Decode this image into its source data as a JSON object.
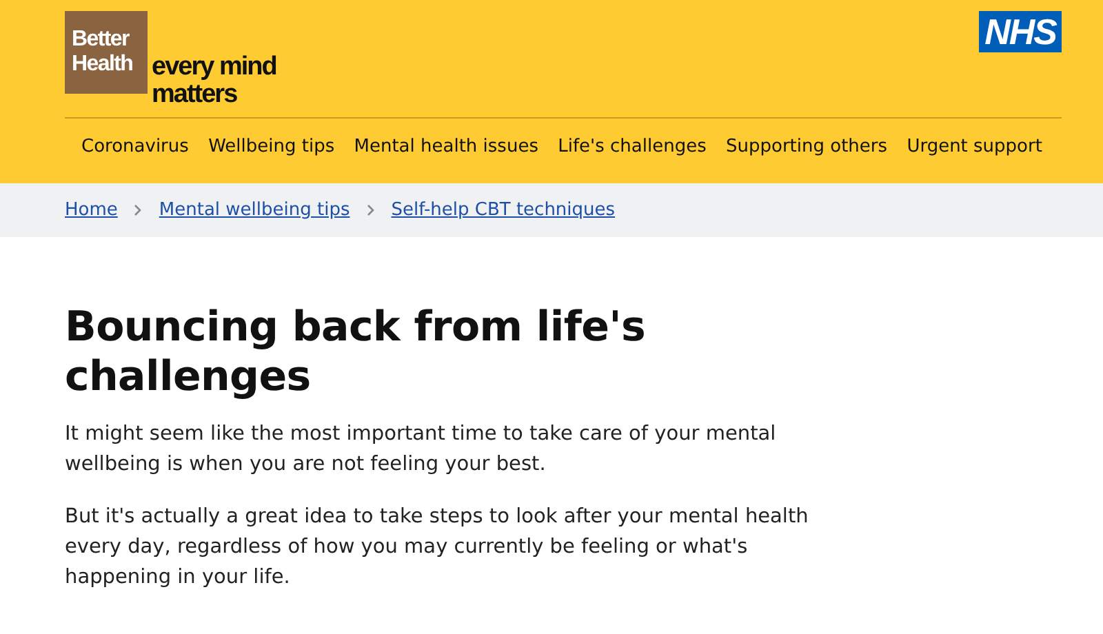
{
  "header": {
    "logo": {
      "box_lines": [
        "Better",
        "Health"
      ],
      "tagline_lines": [
        "every mind",
        "matters"
      ]
    },
    "nhs_logo": "NHS"
  },
  "nav": [
    {
      "label": "Coronavirus"
    },
    {
      "label": "Wellbeing tips"
    },
    {
      "label": "Mental health issues"
    },
    {
      "label": "Life's challenges"
    },
    {
      "label": "Supporting others"
    },
    {
      "label": "Urgent support"
    }
  ],
  "breadcrumbs": [
    {
      "label": "Home"
    },
    {
      "label": "Mental wellbeing tips"
    },
    {
      "label": "Self-help CBT techniques"
    }
  ],
  "heading": "Bouncing back from life's challenges",
  "paragraphs": [
    "It might seem like the most important time to take care of your mental wellbeing is when you are not feeling your best.",
    "But it's actually a great idea to take steps to look after your mental health every day, regardless of how you may currently be feeling or what's happening in your life."
  ]
}
